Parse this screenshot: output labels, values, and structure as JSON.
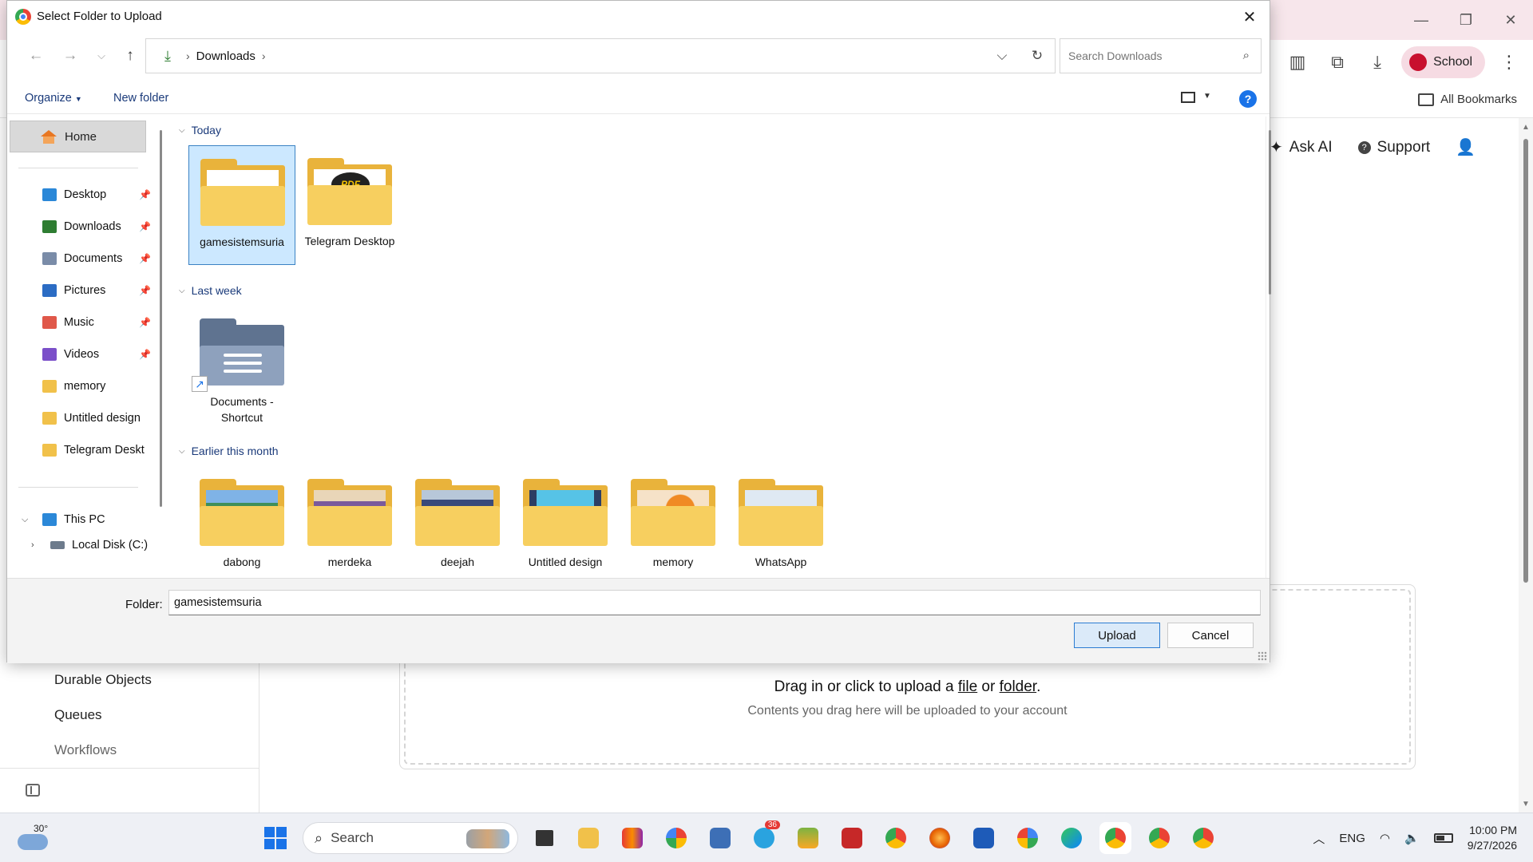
{
  "browser": {
    "profile_label": "School",
    "bookmarks_label": "All Bookmarks",
    "header_items": [
      "Ask AI",
      "Support"
    ]
  },
  "page": {
    "nav_items": [
      "Durable Objects",
      "Queues",
      "Workflows"
    ],
    "upload_text_prefix": "Drag in or click to upload a ",
    "upload_file_link": "file",
    "upload_or": " or ",
    "upload_folder_link": "folder",
    "upload_text_suffix": ".",
    "upload_subtext": "Contents you drag here will be uploaded to your account"
  },
  "dialog": {
    "title": "Select Folder to Upload",
    "breadcrumb": [
      "Downloads"
    ],
    "search_placeholder": "Search Downloads",
    "commands": {
      "organize": "Organize",
      "new_folder": "New folder"
    },
    "nav": {
      "home": "Home",
      "quick_access": [
        {
          "label": "Desktop",
          "pinned": true,
          "color": "#2b88d8"
        },
        {
          "label": "Downloads",
          "pinned": true,
          "color": "#2e7d32"
        },
        {
          "label": "Documents",
          "pinned": true,
          "color": "#7a8ca8"
        },
        {
          "label": "Pictures",
          "pinned": true,
          "color": "#2b6cc4"
        },
        {
          "label": "Music",
          "pinned": true,
          "color": "#e0584a"
        },
        {
          "label": "Videos",
          "pinned": true,
          "color": "#7b4fc9"
        },
        {
          "label": "memory",
          "pinned": false,
          "color": "#f1c14a"
        },
        {
          "label": "Untitled design",
          "pinned": false,
          "color": "#f1c14a"
        },
        {
          "label": "Telegram Deskt",
          "pinned": false,
          "color": "#f1c14a"
        }
      ],
      "this_pc": "This PC",
      "local_disk": "Local Disk (C:)"
    },
    "groups": [
      {
        "heading": "Today",
        "items": [
          "gamesistemsuria",
          "Telegram Desktop"
        ]
      },
      {
        "heading": "Last week",
        "items": [
          "Documents - Shortcut"
        ]
      },
      {
        "heading": "Earlier this month",
        "items": [
          "dabong",
          "merdeka",
          "deejah",
          "Untitled design",
          "memory",
          "WhatsApp"
        ]
      }
    ],
    "folder_label": "Folder:",
    "folder_value": "gamesistemsuria",
    "upload_button": "Upload",
    "cancel_button": "Cancel"
  },
  "taskbar": {
    "temperature": "30°",
    "search_label": "Search",
    "telegram_badge": "36",
    "language": "ENG",
    "time": "10:00 PM",
    "date": "9/27/2026"
  }
}
